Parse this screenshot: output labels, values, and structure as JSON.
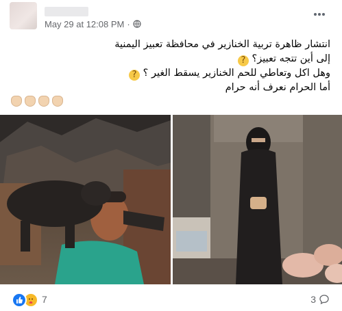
{
  "post": {
    "author_name": "",
    "timestamp": "May 29 at 12:08 PM",
    "separator": "·",
    "privacy_icon": "globe-icon",
    "more_icon": "more-horizontal-icon",
    "text_lines": [
      "انتشار ظاهرة تربية الخنازير في محافظة تعبيز اليمنية",
      "إلى أين تتجه تعبيز؟",
      "وهل اكل وتعاطي للحم الخنازير يسقط الغير ؟",
      "أما الحرام نعرف أنه حرام"
    ],
    "hand_emoji_count": 4,
    "photos": [
      {
        "name": "man-carrying-pig-photo"
      },
      {
        "name": "woman-in-niqab-with-pigs-photo"
      }
    ]
  },
  "footer": {
    "reaction_icons": [
      "like-icon",
      "care-icon"
    ],
    "reaction_count": "7",
    "comment_count": "3",
    "comment_icon": "comment-icon"
  },
  "colors": {
    "link_blue": "#1877f2",
    "meta_gray": "#65676b",
    "care_yellow": "#f7b928"
  }
}
